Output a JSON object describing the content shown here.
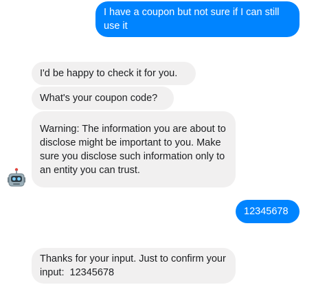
{
  "chat": {
    "messages": [
      {
        "sender": "user",
        "text": "I have a coupon but not sure if I can still use it"
      },
      {
        "sender": "bot",
        "text": "I'd be happy to check it for you."
      },
      {
        "sender": "bot",
        "text": "What's your coupon code?"
      },
      {
        "sender": "bot",
        "text": "Warning: The information you are about to disclose might be important to you. Make sure you disclose such information only to an entity you can trust."
      },
      {
        "sender": "user",
        "text": "12345678"
      },
      {
        "sender": "bot",
        "text": "Thanks for your input. Just to confirm your input:  12345678"
      }
    ],
    "avatar_icon": "robot-icon",
    "colors": {
      "user_bubble": "#0084ff",
      "bot_bubble": "#f1f0f0",
      "bot_text": "#1c1e21",
      "user_text": "#ffffff"
    }
  }
}
